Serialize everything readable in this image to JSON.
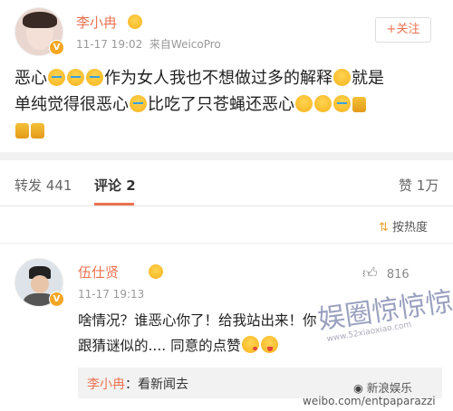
{
  "post": {
    "author": "李小冉",
    "time": "11-17 19:02",
    "source": "来自WeicoPro",
    "follow_label": "+关注",
    "text_a": "恶心",
    "text_b": "作为女人我也不想做过多的解释",
    "text_c": "就是",
    "text_d": "单纯觉得很恶心",
    "text_e": "比吃了只苍蝇还恶心"
  },
  "tabs": {
    "repost_label": "转发",
    "repost_count": "441",
    "comment_label": "评论",
    "comment_count": "2",
    "like_label": "赞",
    "like_count": "1万"
  },
  "sort": {
    "label": "按热度"
  },
  "comment": {
    "author": "伍仕贤",
    "time": "11-17 19:13",
    "likes": "816",
    "text_1": "啥情况？谁恶心你了！给我站出来！你",
    "text_2": "跟猜谜似的.... 同意的点赞",
    "reply_author": "李小冉",
    "reply_sep": "：",
    "reply_text": "看新闻去"
  },
  "watermarks": {
    "site_logo": "娱圈惊惊惊",
    "site_url": "www.52xiaoxiao.com",
    "footer_brand": "新浪娱乐",
    "footer_url": "weibo.com/entpaparazzi"
  },
  "colors": {
    "accent": "#eb7350",
    "verified": "#f5a623",
    "emoji": "#f6b21c"
  },
  "icons": [
    "verified-badge-icon",
    "crying-emoji-icon",
    "blushing-emoji-icon",
    "thumbs-down-icon",
    "sort-icon",
    "thumbs-up-icon",
    "kiss-emoji-icon",
    "tongue-emoji-icon"
  ]
}
